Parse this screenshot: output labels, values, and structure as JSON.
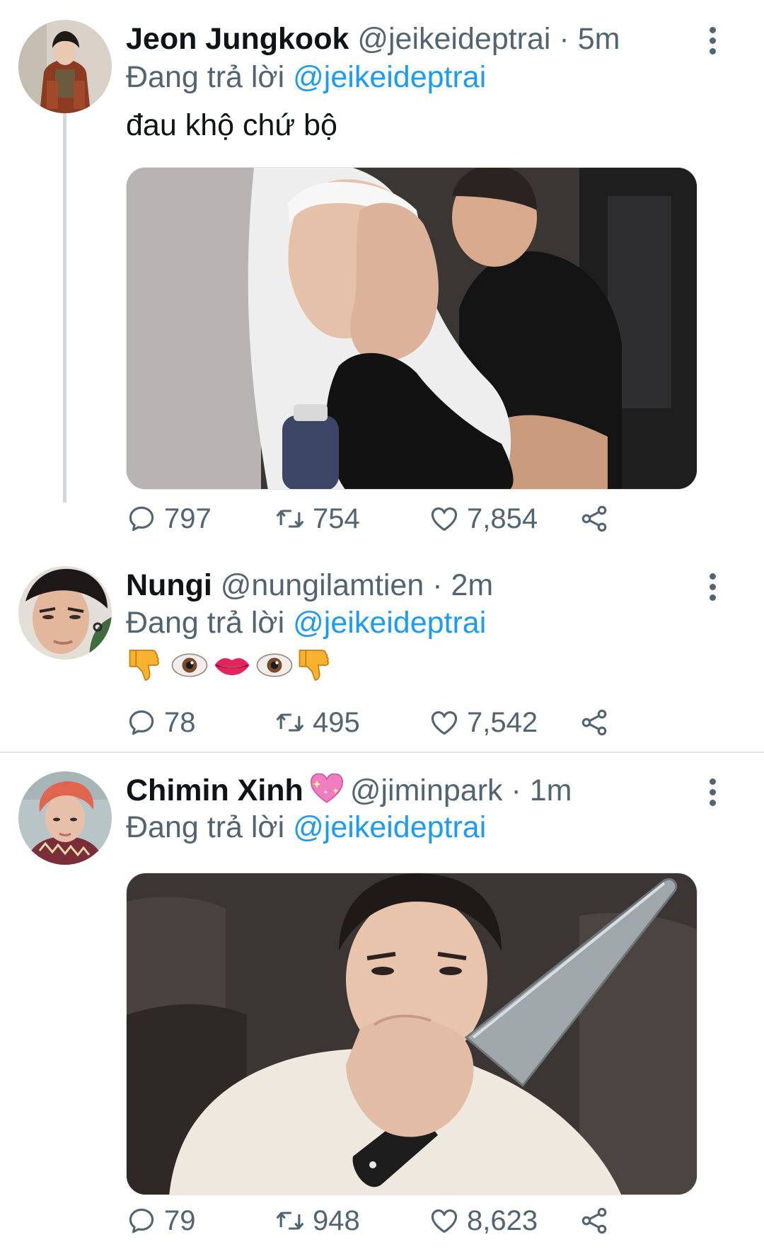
{
  "tweets": [
    {
      "name": "Jeon Jungkook",
      "handle": "@jeikeideptrai",
      "separator": "·",
      "time": "5m",
      "replying_prefix": "Đang trả lời",
      "replying_to": "@jeikeideptrai",
      "text": "đau khộ chứ bộ",
      "media": "crying-person-photo",
      "counts": {
        "replies": "797",
        "retweets": "754",
        "likes": "7,854"
      }
    },
    {
      "name": "Nungi",
      "handle": "@nungilamtien",
      "separator": "·",
      "time": "2m",
      "replying_prefix": "Đang trả lời",
      "replying_to": "@jeikeideptrai",
      "emoji_text": [
        "thumbs-down",
        "eye",
        "lips",
        "eye",
        "thumbs-down"
      ],
      "counts": {
        "replies": "78",
        "retweets": "495",
        "likes": "7,542"
      }
    },
    {
      "name": "Chimin Xinh",
      "name_emoji": "sparkling-heart",
      "handle": "@jiminpark",
      "separator": "·",
      "time": "1m",
      "replying_prefix": "Đang trả lời",
      "replying_to": "@jeikeideptrai",
      "media": "person-with-knife-photo",
      "counts": {
        "replies": "79",
        "retweets": "948",
        "likes": "8,623"
      }
    }
  ],
  "colors": {
    "text": "#0f1419",
    "secondary": "#536471",
    "link": "#1d9bf0",
    "thread_line": "#cfd9de"
  }
}
